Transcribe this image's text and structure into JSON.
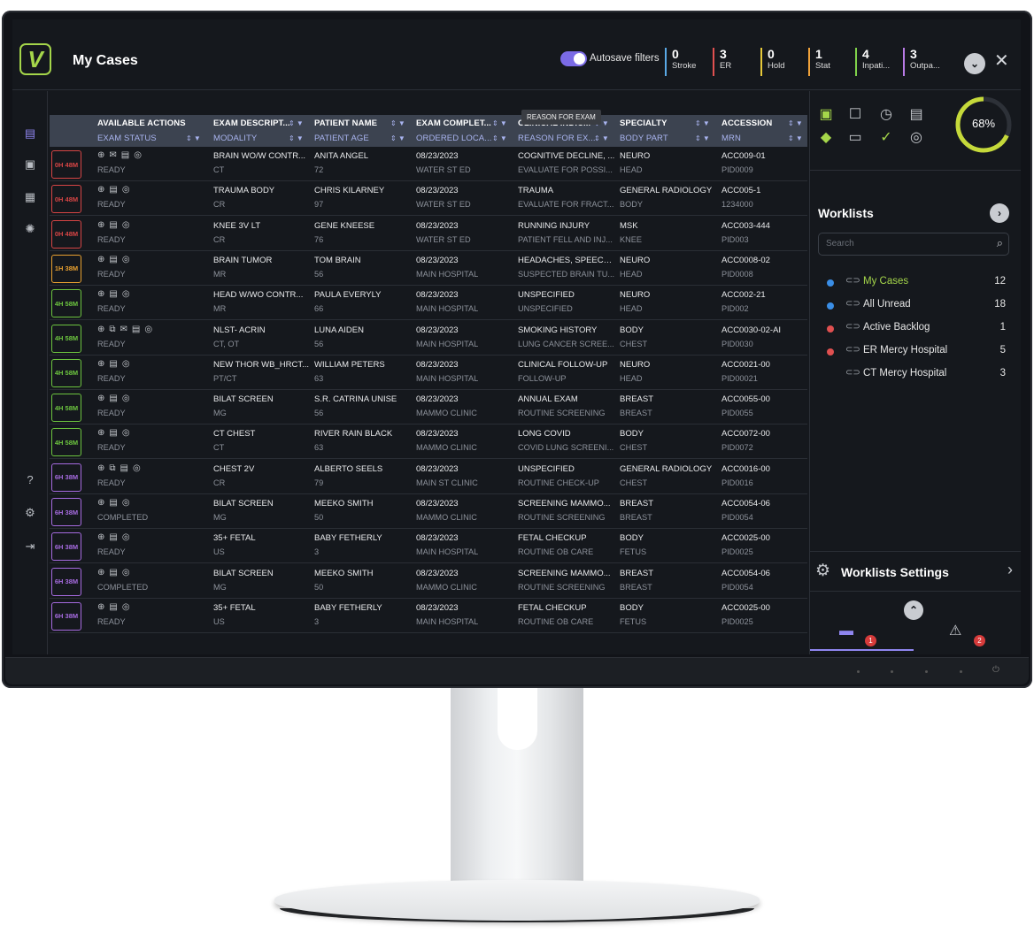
{
  "header": {
    "title": "My Cases",
    "autosave_label": "Autosave filters",
    "counters": [
      {
        "num": "0",
        "label": "Stroke",
        "color": "#5aa9e6"
      },
      {
        "num": "3",
        "label": "ER",
        "color": "#e05050"
      },
      {
        "num": "0",
        "label": "Hold",
        "color": "#e6c93a"
      },
      {
        "num": "1",
        "label": "Stat",
        "color": "#f0a23a"
      },
      {
        "num": "4",
        "label": "Inpati...",
        "color": "#7fd14a"
      },
      {
        "num": "3",
        "label": "Outpa...",
        "color": "#b87be6"
      }
    ]
  },
  "table": {
    "tooltip": "REASON FOR EXAM",
    "headers_top": [
      "AVAILABLE ACTIONS",
      "EXAM DESCRIPT...",
      "PATIENT NAME",
      "EXAM COMPLET...",
      "CLINICAL INDIC...",
      "SPECIALTY",
      "ACCESSION"
    ],
    "headers_sub": [
      "EXAM STATUS",
      "MODALITY",
      "PATIENT AGE",
      "ORDERED LOCA...",
      "REASON FOR EX...",
      "BODY PART",
      "MRN"
    ],
    "rows": [
      {
        "badge": "0H 48M",
        "color": "#d64545",
        "actions": "⊕✉▤◎",
        "status": "READY",
        "desc": "BRAIN WO/W CONTR...",
        "mod": "CT",
        "name": "ANITA ANGEL",
        "age": "72",
        "date": "08/23/2023",
        "loc": "WATER ST ED",
        "ind": "COGNITIVE DECLINE, ...",
        "reason": "EVALUATE FOR POSSI...",
        "spec": "NEURO",
        "body": "HEAD",
        "acc": "ACC009-01",
        "mrn": "PID0009"
      },
      {
        "badge": "0H 48M",
        "color": "#d64545",
        "actions": "⊕▤◎",
        "status": "READY",
        "desc": "TRAUMA BODY",
        "mod": "CR",
        "name": "CHRIS KILARNEY",
        "age": "97",
        "date": "08/23/2023",
        "loc": "WATER ST ED",
        "ind": "TRAUMA",
        "reason": "EVALUATE FOR FRACT...",
        "spec": "GENERAL RADIOLOGY",
        "body": "BODY",
        "acc": "ACC005-1",
        "mrn": "1234000"
      },
      {
        "badge": "0H 48M",
        "color": "#d64545",
        "actions": "⊕▤◎",
        "status": "READY",
        "desc": "KNEE 3V LT",
        "mod": "CR",
        "name": "GENE KNEESE",
        "age": "76",
        "date": "08/23/2023",
        "loc": "WATER ST ED",
        "ind": "RUNNING INJURY",
        "reason": "PATIENT FELL AND INJ...",
        "spec": "MSK",
        "body": "KNEE",
        "acc": "ACC003-444",
        "mrn": "PID003"
      },
      {
        "badge": "1H 38M",
        "color": "#e8a030",
        "actions": "⊕▤◎",
        "status": "READY",
        "desc": "BRAIN TUMOR",
        "mod": "MR",
        "name": "TOM BRAIN",
        "age": "56",
        "date": "08/23/2023",
        "loc": "MAIN HOSPITAL",
        "ind": "HEADACHES, SPEECH ...",
        "reason": "SUSPECTED BRAIN TU...",
        "spec": "NEURO",
        "body": "HEAD",
        "acc": "ACC0008-02",
        "mrn": "PID0008"
      },
      {
        "badge": "4H 58M",
        "color": "#6cc43f",
        "actions": "⊕▤◎",
        "status": "READY",
        "desc": "HEAD W/WO CONTR...",
        "mod": "MR",
        "name": "PAULA EVERYLY",
        "age": "66",
        "date": "08/23/2023",
        "loc": "MAIN HOSPITAL",
        "ind": "UNSPECIFIED",
        "reason": "UNSPECIFIED",
        "spec": "NEURO",
        "body": "HEAD",
        "acc": "ACC002-21",
        "mrn": "PID002"
      },
      {
        "badge": "4H 58M",
        "color": "#6cc43f",
        "actions": "⊕⧉✉▤◎",
        "status": "READY",
        "desc": "NLST- ACRIN",
        "mod": "CT, OT",
        "name": "LUNA AIDEN",
        "age": "56",
        "date": "08/23/2023",
        "loc": "MAIN HOSPITAL",
        "ind": "SMOKING HISTORY",
        "reason": "LUNG CANCER SCREE...",
        "spec": "BODY",
        "body": "CHEST",
        "acc": "ACC0030-02-AI",
        "mrn": "PID0030"
      },
      {
        "badge": "4H 58M",
        "color": "#6cc43f",
        "actions": "⊕▤◎",
        "status": "READY",
        "desc": "NEW THOR WB_HRCT...",
        "mod": "PT/CT",
        "name": "WILLIAM PETERS",
        "age": "63",
        "date": "08/23/2023",
        "loc": "MAIN HOSPITAL",
        "ind": "CLINICAL FOLLOW-UP",
        "reason": "FOLLOW-UP",
        "spec": "NEURO",
        "body": "HEAD",
        "acc": "ACC0021-00",
        "mrn": "PID00021"
      },
      {
        "badge": "4H 58M",
        "color": "#6cc43f",
        "actions": "⊕▤◎",
        "status": "READY",
        "desc": "BILAT SCREEN",
        "mod": "MG",
        "name": "S.R. CATRINA UNISE",
        "age": "56",
        "date": "08/23/2023",
        "loc": "MAMMO CLINIC",
        "ind": "ANNUAL EXAM",
        "reason": "ROUTINE SCREENING",
        "spec": "BREAST",
        "body": "BREAST",
        "acc": "ACC0055-00",
        "mrn": "PID0055"
      },
      {
        "badge": "4H 58M",
        "color": "#6cc43f",
        "actions": "⊕▤◎",
        "status": "READY",
        "desc": "CT CHEST",
        "mod": "CT",
        "name": "RIVER RAIN BLACK",
        "age": "63",
        "date": "08/23/2023",
        "loc": "MAMMO CLINIC",
        "ind": "LONG COVID",
        "reason": "COVID LUNG SCREENI...",
        "spec": "BODY",
        "body": "CHEST",
        "acc": "ACC0072-00",
        "mrn": "PID0072"
      },
      {
        "badge": "6H 38M",
        "color": "#a66be0",
        "actions": "⊕⧉▤◎",
        "status": "READY",
        "desc": "CHEST 2V",
        "mod": "CR",
        "name": "ALBERTO SEELS",
        "age": "79",
        "date": "08/23/2023",
        "loc": "MAIN ST CLINIC",
        "ind": "UNSPECIFIED",
        "reason": "ROUTINE CHECK-UP",
        "spec": "GENERAL RADIOLOGY",
        "body": "CHEST",
        "acc": "ACC0016-00",
        "mrn": "PID0016"
      },
      {
        "badge": "6H 38M",
        "color": "#a66be0",
        "actions": "⊕▤◎",
        "status": "COMPLETED",
        "desc": "BILAT SCREEN",
        "mod": "MG",
        "name": "MEEKO SMITH",
        "age": "50",
        "date": "08/23/2023",
        "loc": "MAMMO CLINIC",
        "ind": "SCREENING MAMMO...",
        "reason": "ROUTINE SCREENING",
        "spec": "BREAST",
        "body": "BREAST",
        "acc": "ACC0054-06",
        "mrn": "PID0054"
      },
      {
        "badge": "6H 38M",
        "color": "#a66be0",
        "actions": "⊕▤◎",
        "status": "READY",
        "desc": "35+ FETAL",
        "mod": "US",
        "name": "BABY FETHERLY",
        "age": "3",
        "date": "08/23/2023",
        "loc": "MAIN HOSPITAL",
        "ind": "FETAL CHECKUP",
        "reason": "ROUTINE OB CARE",
        "spec": "BODY",
        "body": "FETUS",
        "acc": "ACC0025-00",
        "mrn": "PID0025"
      },
      {
        "badge": "6H 38M",
        "color": "#a66be0",
        "actions": "⊕▤◎",
        "status": "COMPLETED",
        "desc": "BILAT SCREEN",
        "mod": "MG",
        "name": "MEEKO SMITH",
        "age": "50",
        "date": "08/23/2023",
        "loc": "MAMMO CLINIC",
        "ind": "SCREENING MAMMO...",
        "reason": "ROUTINE SCREENING",
        "spec": "BREAST",
        "body": "BREAST",
        "acc": "ACC0054-06",
        "mrn": "PID0054"
      },
      {
        "badge": "6H 38M",
        "color": "#a66be0",
        "actions": "⊕▤◎",
        "status": "READY",
        "desc": "35+ FETAL",
        "mod": "US",
        "name": "BABY FETHERLY",
        "age": "3",
        "date": "08/23/2023",
        "loc": "MAIN HOSPITAL",
        "ind": "FETAL CHECKUP",
        "reason": "ROUTINE OB CARE",
        "spec": "BODY",
        "body": "FETUS",
        "acc": "ACC0025-00",
        "mrn": "PID0025"
      }
    ]
  },
  "right": {
    "progress_text": "68%",
    "progress_value": 0.68,
    "worklists_title": "Worklists",
    "search_placeholder": "Search",
    "worklists": [
      {
        "name": "My Cases",
        "count": "12",
        "dot": "#3a8ee6",
        "active": true
      },
      {
        "name": "All Unread",
        "count": "18",
        "dot": "#3a8ee6",
        "active": false
      },
      {
        "name": "Active Backlog",
        "count": "1",
        "dot": "#e05050",
        "active": false
      },
      {
        "name": "ER Mercy Hospital",
        "count": "5",
        "dot": "#e05050",
        "active": false
      },
      {
        "name": "CT Mercy Hospital",
        "count": "3",
        "dot": "",
        "active": false
      }
    ],
    "settings_label": "Worklists Settings",
    "messages_count": "1",
    "alerts_count": "2"
  }
}
